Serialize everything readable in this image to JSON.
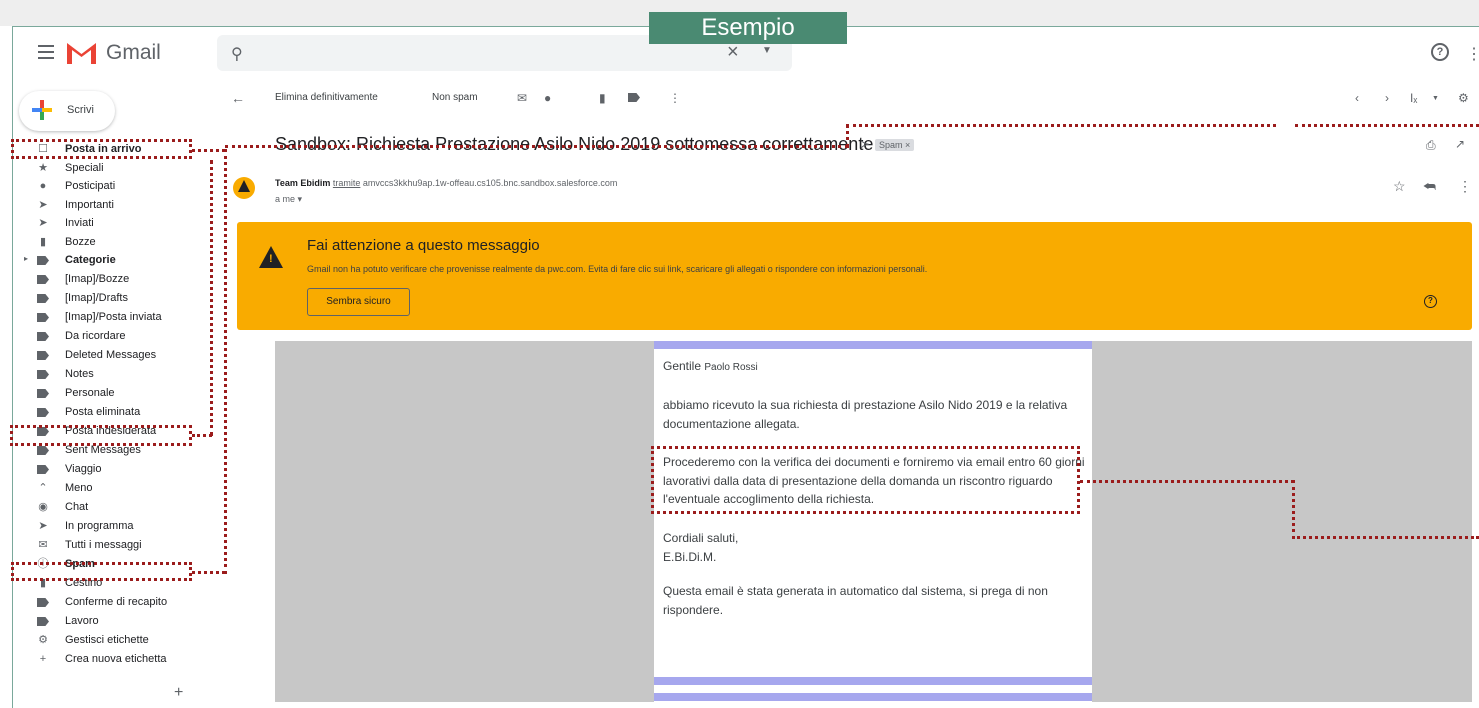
{
  "banner": {
    "label": "Esempio"
  },
  "header": {
    "app_name": "Gmail",
    "search": {
      "value": "",
      "placeholder": ""
    }
  },
  "compose": {
    "label": "Scrivi"
  },
  "sidebar": {
    "items": [
      {
        "label": "Posta in arrivo",
        "icon": "inbox-icon",
        "bold": true
      },
      {
        "label": "Speciali",
        "icon": "star-icon"
      },
      {
        "label": "Posticipati",
        "icon": "clock-icon"
      },
      {
        "label": "Importanti",
        "icon": "important-icon"
      },
      {
        "label": "Inviati",
        "icon": "send-icon"
      },
      {
        "label": "Bozze",
        "icon": "draft-icon"
      },
      {
        "label": "Categorie",
        "icon": "label-icon",
        "bold": true
      },
      {
        "label": "[Imap]/Bozze",
        "icon": "label-icon"
      },
      {
        "label": "[Imap]/Drafts",
        "icon": "label-icon"
      },
      {
        "label": "[Imap]/Posta inviata",
        "icon": "label-icon"
      },
      {
        "label": "Da ricordare",
        "icon": "label-icon"
      },
      {
        "label": "Deleted Messages",
        "icon": "label-icon"
      },
      {
        "label": "Notes",
        "icon": "label-icon"
      },
      {
        "label": "Personale",
        "icon": "label-icon"
      },
      {
        "label": "Posta eliminata",
        "icon": "label-icon"
      },
      {
        "label": "Posta indesiderata",
        "icon": "label-icon"
      },
      {
        "label": "Sent Messages",
        "icon": "label-icon"
      },
      {
        "label": "Viaggio",
        "icon": "label-icon"
      },
      {
        "label": "Meno",
        "icon": "chevron-up-icon"
      },
      {
        "label": "Chat",
        "icon": "chat-icon"
      },
      {
        "label": "In programma",
        "icon": "scheduled-icon"
      },
      {
        "label": "Tutti i messaggi",
        "icon": "all-mail-icon"
      },
      {
        "label": "Spam",
        "icon": "spam-icon",
        "bold": true
      },
      {
        "label": "Cestino",
        "icon": "trash-icon"
      },
      {
        "label": "Conferme di recapito",
        "icon": "label-icon"
      },
      {
        "label": "Lavoro",
        "icon": "label-icon"
      },
      {
        "label": "Gestisci etichette",
        "icon": "gear-icon"
      },
      {
        "label": "Crea nuova etichetta",
        "icon": "plus-icon"
      }
    ]
  },
  "toolbar": {
    "delete_forever": "Elimina definitivamente",
    "not_spam": "Non spam",
    "input_tools": "Iₓ"
  },
  "message": {
    "subject": "Sandbox: Richiesta Prestazione Asilo Nido 2019 sottomessa correttamente",
    "label_badge": "Spam ×",
    "sender_name": "Team Ebidim",
    "via": "tramite",
    "sender_domain": "amvccs3kkhu9ap.1w-offeau.cs105.bnc.sandbox.salesforce.com",
    "to": "a me ▾"
  },
  "warning": {
    "title": "Fai attenzione a questo messaggio",
    "text": "Gmail non ha potuto verificare che provenisse realmente da pwc.com. Evita di fare clic sui link, scaricare gli allegati o rispondere con informazioni personali.",
    "button": "Sembra sicuro",
    "color": "#f9ab00"
  },
  "body": {
    "greeting": "Gentile",
    "recipient": "Paolo Rossi",
    "p1": "abbiamo ricevuto la sua richiesta di prestazione Asilo Nido 2019 e la relativa documentazione allegata.",
    "p2": "Procederemo con la verifica dei documenti e forniremo via email entro 60 giorni lavorativi dalla data di presentazione della domanda un riscontro riguardo l'eventuale accoglimento della richiesta.",
    "closing1": "Cordiali saluti,",
    "closing2": "E.Bi.Di.M.",
    "footer": "Questa email è stata generata in automatico dal sistema, si prega di non rispondere."
  },
  "colors": {
    "annotation": "#9b1c1c",
    "banner": "#4a8a72",
    "card_bar": "#a6a7ee"
  }
}
